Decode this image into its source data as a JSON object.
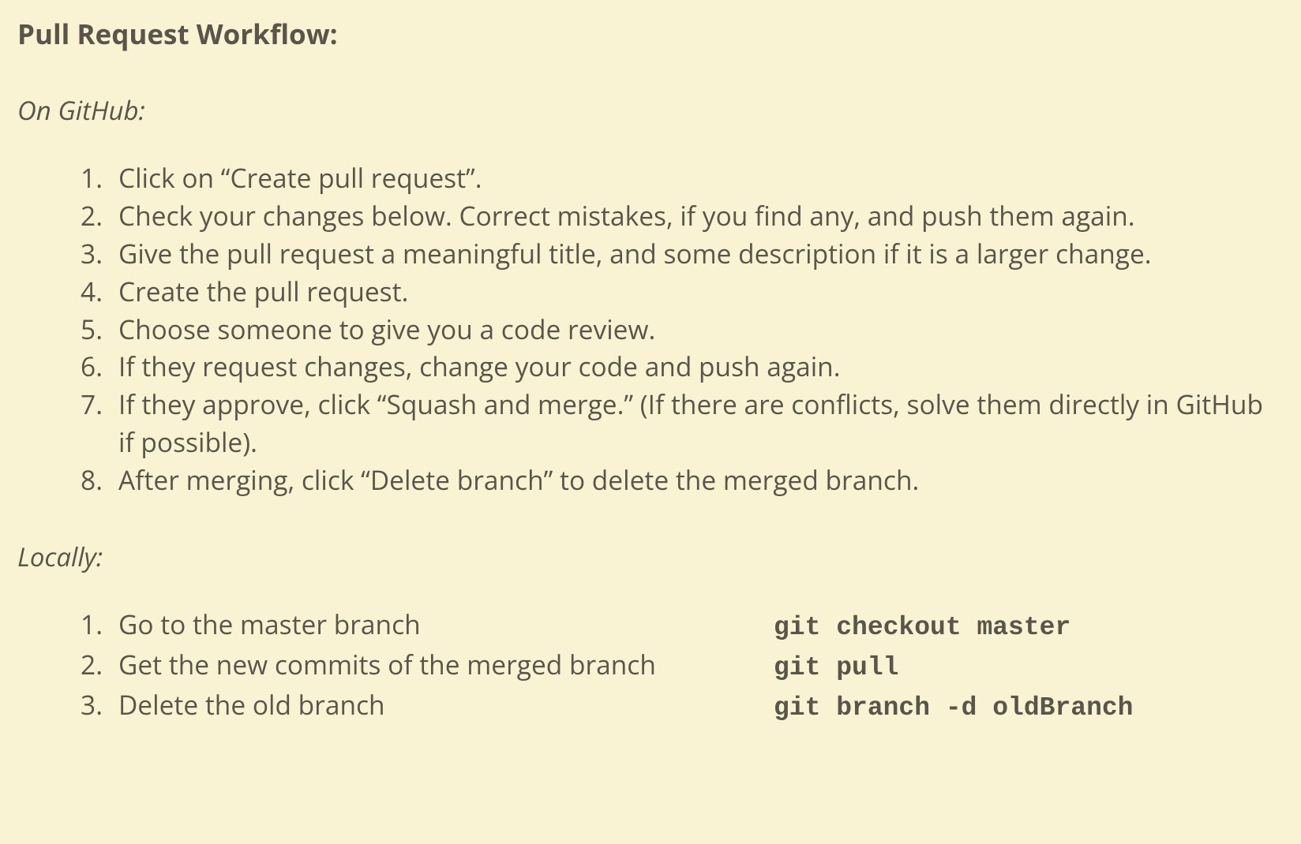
{
  "title": "Pull Request Workflow:",
  "sections": {
    "github": {
      "heading": "On GitHub:",
      "steps": [
        "Click on “Create pull request”.",
        "Check your changes below. Correct mistakes, if you find any, and push them again.",
        "Give the pull request a meaningful title, and some description if it is a larger change.",
        "Create the pull request.",
        "Choose someone to give you a code review.",
        "If they request changes, change your code and push again.",
        "If they approve, click “Squash and merge.” (If there are conflicts, solve them directly in GitHub if possible).",
        "After merging, click “Delete branch” to delete the merged branch."
      ]
    },
    "locally": {
      "heading": "Locally:",
      "steps": [
        {
          "text": "Go to the master branch",
          "cmd": "git checkout master"
        },
        {
          "text": "Get the new commits of the merged branch",
          "cmd": "git pull"
        },
        {
          "text": "Delete the old branch",
          "cmd": "git branch -d oldBranch"
        }
      ]
    }
  }
}
